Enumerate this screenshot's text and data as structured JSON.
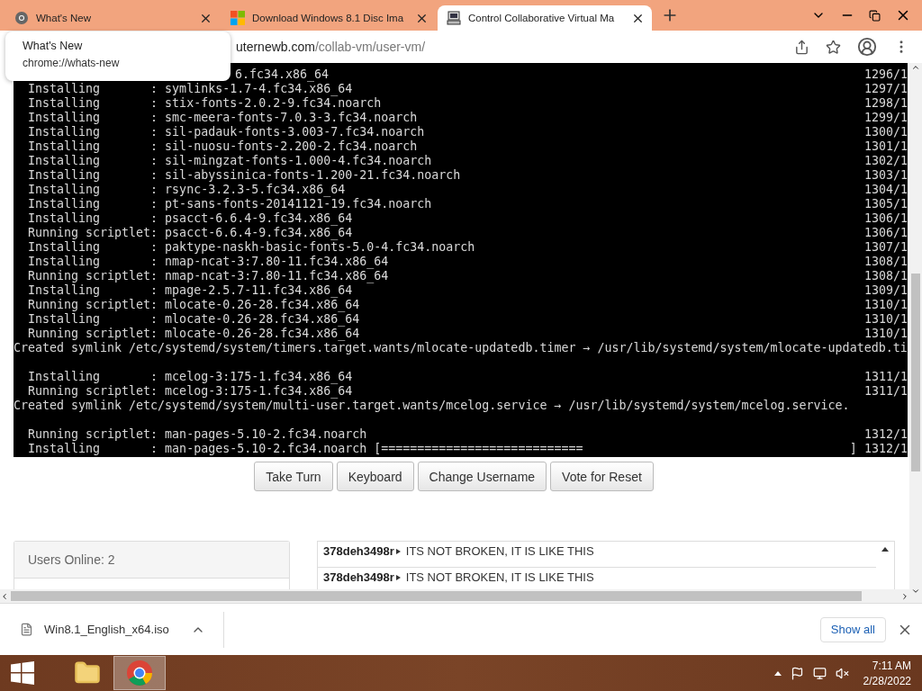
{
  "tabs": [
    {
      "title": "What's New",
      "selected": false
    },
    {
      "title": "Download Windows 8.1 Disc Ima",
      "selected": false
    },
    {
      "title": "Control Collaborative Virtual Ma",
      "selected": true
    }
  ],
  "address_bar": {
    "host": "uternewb.com",
    "path": "/collab-vm/user-vm/"
  },
  "tooltip": {
    "title": "What's New",
    "url": "chrome://whats-new"
  },
  "terminal": {
    "lines": [
      {
        "kind": "partial",
        "text": "6.fc34.x86_64",
        "counter": "1296/1"
      },
      {
        "kind": "line",
        "text": "  Installing       : symlinks-1.7-4.fc34.x86_64",
        "counter": "1297/1"
      },
      {
        "kind": "line",
        "text": "  Installing       : stix-fonts-2.0.2-9.fc34.noarch",
        "counter": "1298/1"
      },
      {
        "kind": "line",
        "text": "  Installing       : smc-meera-fonts-7.0.3-3.fc34.noarch",
        "counter": "1299/1"
      },
      {
        "kind": "line",
        "text": "  Installing       : sil-padauk-fonts-3.003-7.fc34.noarch",
        "counter": "1300/1"
      },
      {
        "kind": "line",
        "text": "  Installing       : sil-nuosu-fonts-2.200-2.fc34.noarch",
        "counter": "1301/1"
      },
      {
        "kind": "line",
        "text": "  Installing       : sil-mingzat-fonts-1.000-4.fc34.noarch",
        "counter": "1302/1"
      },
      {
        "kind": "line",
        "text": "  Installing       : sil-abyssinica-fonts-1.200-21.fc34.noarch",
        "counter": "1303/1"
      },
      {
        "kind": "line",
        "text": "  Installing       : rsync-3.2.3-5.fc34.x86_64",
        "counter": "1304/1"
      },
      {
        "kind": "line",
        "text": "  Installing       : pt-sans-fonts-20141121-19.fc34.noarch",
        "counter": "1305/1"
      },
      {
        "kind": "line",
        "text": "  Installing       : psacct-6.6.4-9.fc34.x86_64",
        "counter": "1306/1"
      },
      {
        "kind": "line",
        "text": "  Running scriptlet: psacct-6.6.4-9.fc34.x86_64",
        "counter": "1306/1"
      },
      {
        "kind": "line",
        "text": "  Installing       : paktype-naskh-basic-fonts-5.0-4.fc34.noarch",
        "counter": "1307/1"
      },
      {
        "kind": "line",
        "text": "  Installing       : nmap-ncat-3:7.80-11.fc34.x86_64",
        "counter": "1308/1"
      },
      {
        "kind": "line",
        "text": "  Running scriptlet: nmap-ncat-3:7.80-11.fc34.x86_64",
        "counter": "1308/1"
      },
      {
        "kind": "line",
        "text": "  Installing       : mpage-2.5.7-11.fc34.x86_64",
        "counter": "1309/1"
      },
      {
        "kind": "line",
        "text": "  Running scriptlet: mlocate-0.26-28.fc34.x86_64",
        "counter": "1310/1"
      },
      {
        "kind": "line",
        "text": "  Installing       : mlocate-0.26-28.fc34.x86_64",
        "counter": "1310/1"
      },
      {
        "kind": "line",
        "text": "  Running scriptlet: mlocate-0.26-28.fc34.x86_64",
        "counter": "1310/1"
      },
      {
        "kind": "line",
        "text": "Created symlink /etc/systemd/system/timers.target.wants/mlocate-updatedb.timer → /usr/lib/systemd/system/mlocate-updatedb.ti"
      },
      {
        "kind": "blank"
      },
      {
        "kind": "line",
        "text": "  Installing       : mcelog-3:175-1.fc34.x86_64",
        "counter": "1311/1"
      },
      {
        "kind": "line",
        "text": "  Running scriptlet: mcelog-3:175-1.fc34.x86_64",
        "counter": "1311/1"
      },
      {
        "kind": "line",
        "text": "Created symlink /etc/systemd/system/multi-user.target.wants/mcelog.service → /usr/lib/systemd/system/mcelog.service."
      },
      {
        "kind": "blank"
      },
      {
        "kind": "line",
        "text": "  Running scriptlet: man-pages-5.10-2.fc34.noarch",
        "counter": "1312/1"
      },
      {
        "kind": "line",
        "text": "  Installing       : man-pages-5.10-2.fc34.noarch [============================                                     ]",
        "counter": "1312/1"
      }
    ]
  },
  "vm_buttons": [
    "Take Turn",
    "Keyboard",
    "Change Username",
    "Vote for Reset"
  ],
  "users_panel": {
    "title": "Users Online: 2"
  },
  "chat": [
    {
      "user": "378deh3498r",
      "message": "ITS NOT BROKEN, IT IS LIKE THIS"
    },
    {
      "user": "378deh3498r",
      "message": "ITS NOT BROKEN, IT IS LIKE THIS"
    }
  ],
  "downloads": {
    "file": "Win8.1_English_x64.iso",
    "show_all": "Show all"
  },
  "taskbar": {
    "apps": [
      {
        "selected": false
      },
      {
        "selected": true
      }
    ],
    "time": "7:11 AM",
    "date": "2/28/2022"
  }
}
